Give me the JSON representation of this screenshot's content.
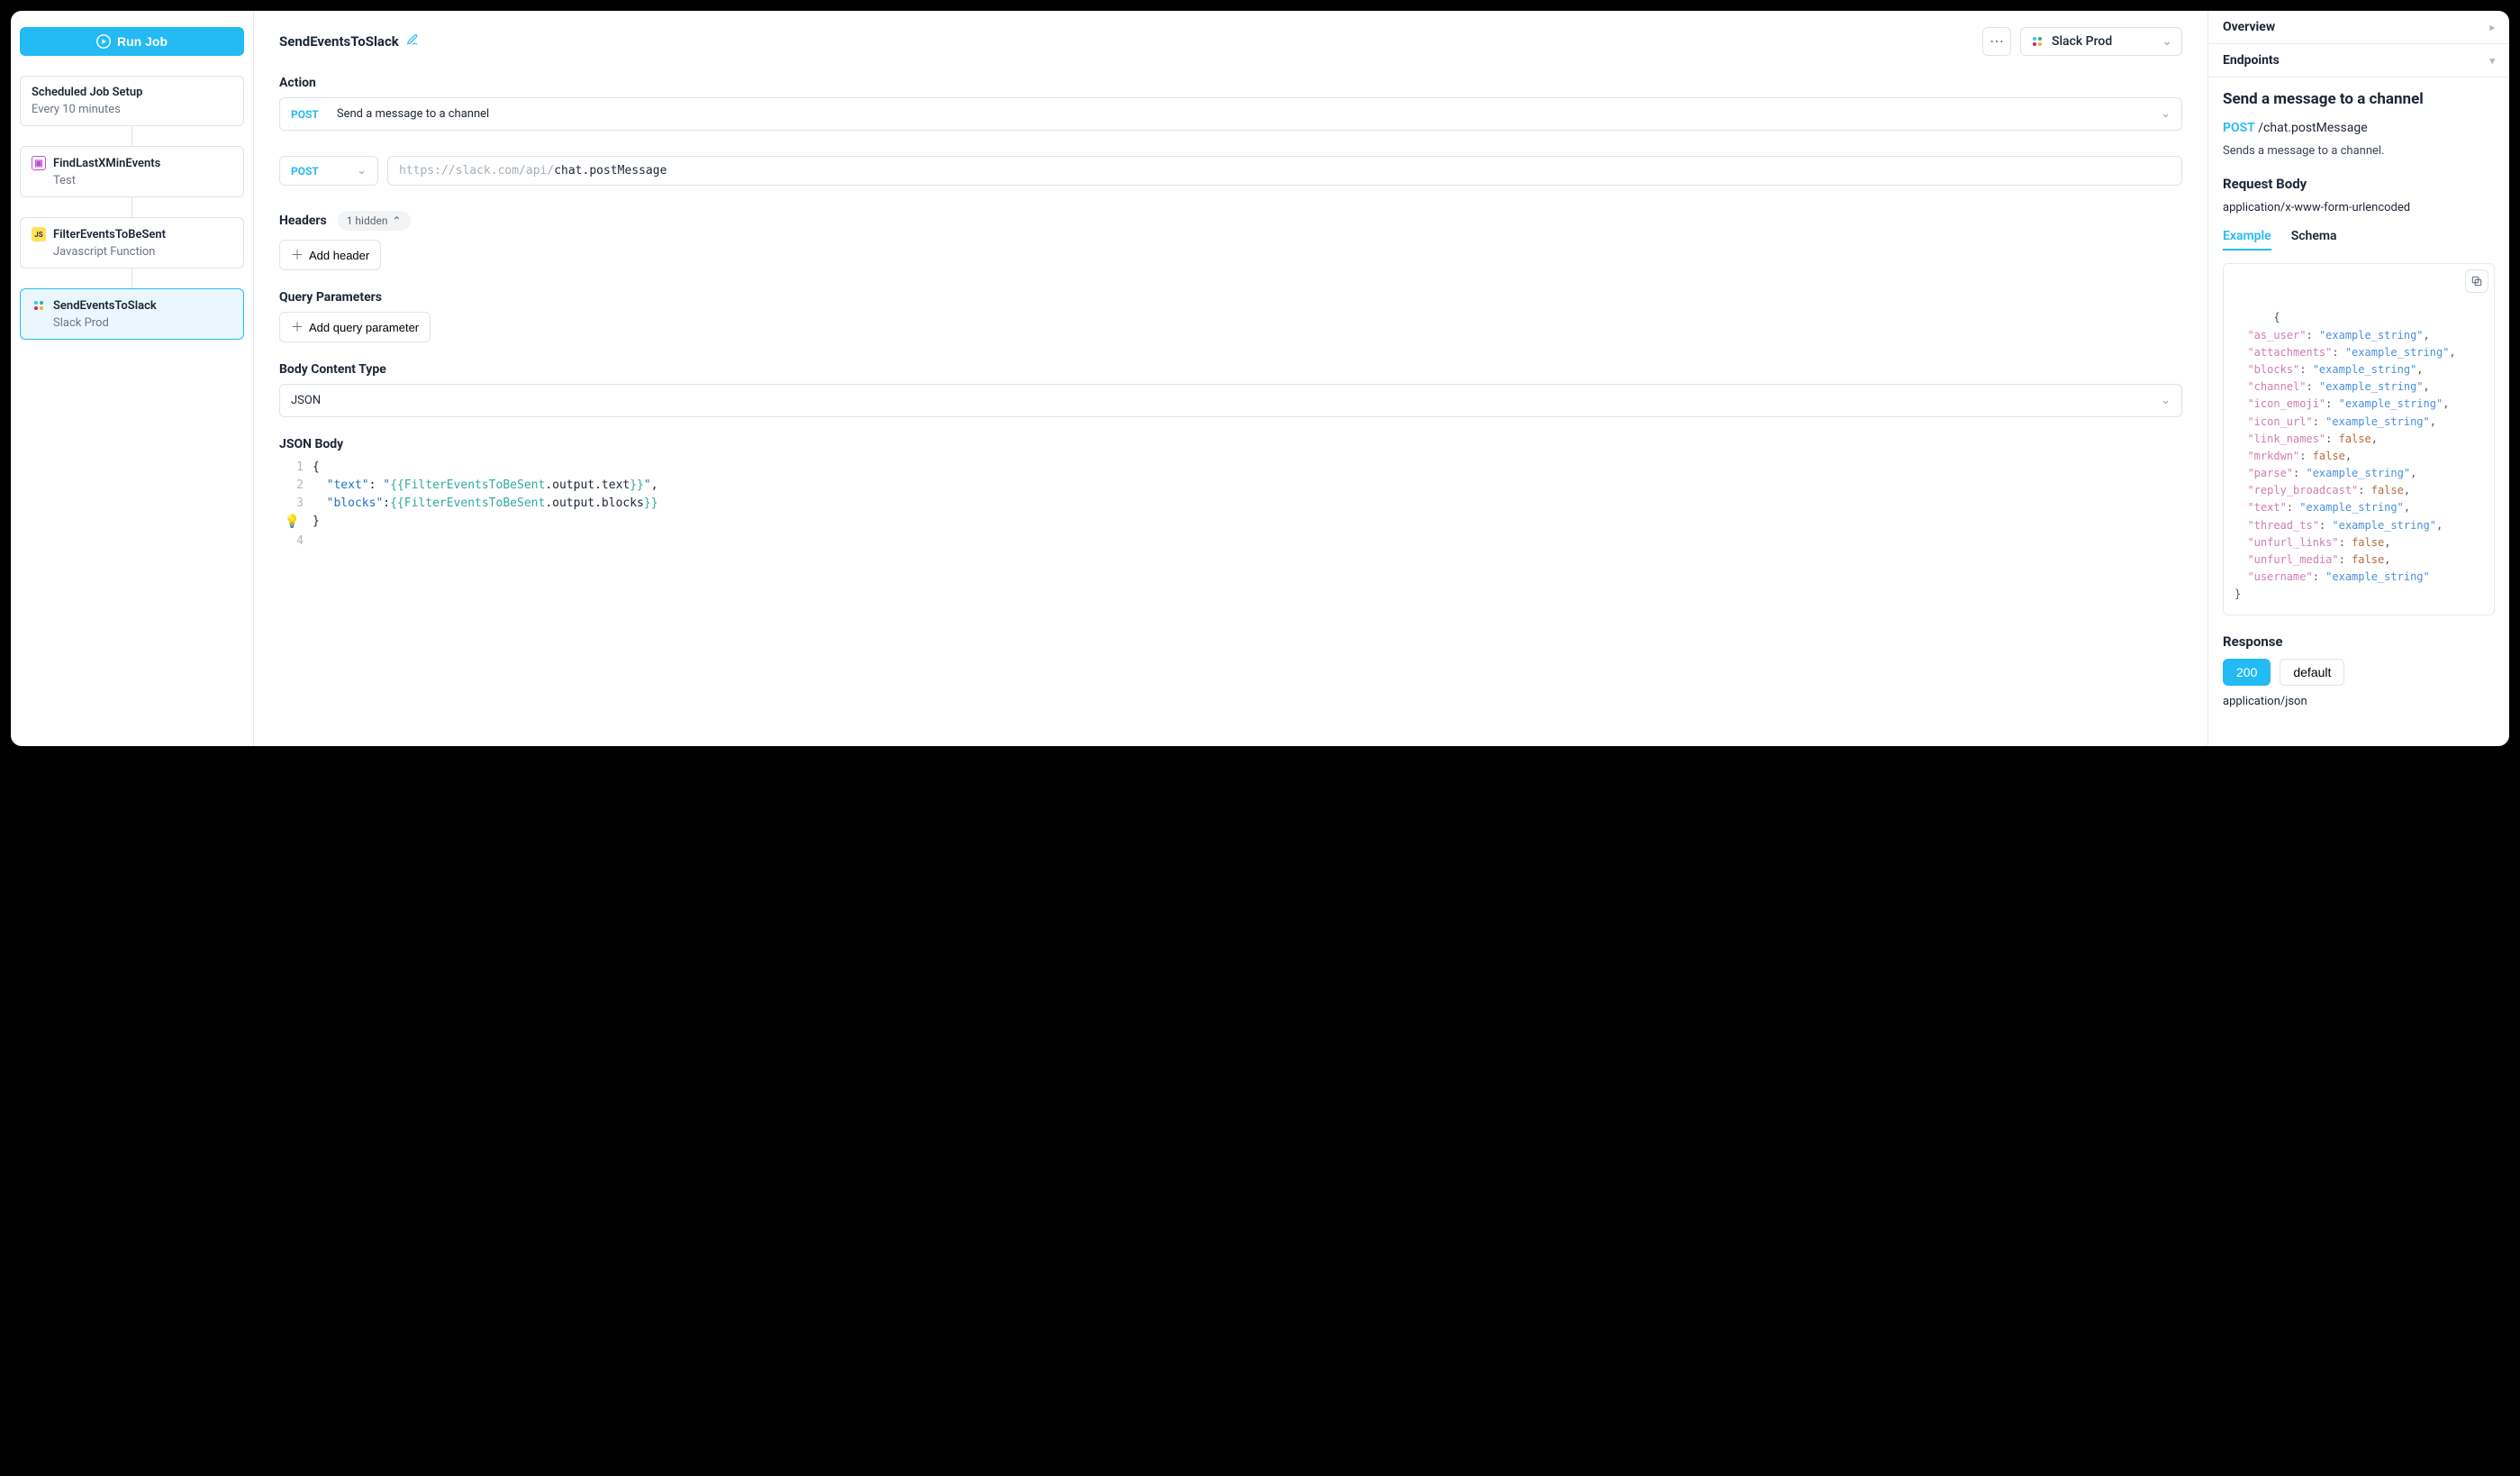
{
  "sidebar": {
    "run_label": "Run Job",
    "nodes": [
      {
        "title": "Scheduled Job Setup",
        "subtitle": "Every 10 minutes",
        "icon": null
      },
      {
        "title": "FindLastXMinEvents",
        "subtitle": "Test",
        "icon": "pink"
      },
      {
        "title": "FilterEventsToBeSent",
        "subtitle": "Javascript Function",
        "icon": "js"
      },
      {
        "title": "SendEventsToSlack",
        "subtitle": "Slack Prod",
        "icon": "slack"
      }
    ]
  },
  "main": {
    "title": "SendEventsToSlack",
    "integration_label": "Slack Prod",
    "action_label": "Action",
    "action_method": "POST",
    "action_text": "Send a message to a channel",
    "req_method": "POST",
    "url_prefix": "https://slack.com/api/",
    "url_path": "chat.postMessage",
    "headers_label": "Headers",
    "headers_hidden": "1 hidden",
    "add_header": "Add header",
    "query_label": "Query Parameters",
    "add_query": "Add query parameter",
    "body_type_label": "Body Content Type",
    "body_type_value": "JSON",
    "json_body_label": "JSON Body",
    "json_lines": [
      {
        "n": "1",
        "tokens": [
          [
            "brace",
            "{"
          ]
        ]
      },
      {
        "n": "2",
        "tokens": [
          [
            "indent",
            "  "
          ],
          [
            "key",
            "\"text\""
          ],
          [
            "punct",
            ": "
          ],
          [
            "str",
            "\""
          ],
          [
            "varb",
            "{{"
          ],
          [
            "var",
            "FilterEventsToBeSent"
          ],
          [
            "punct2",
            ".output.text"
          ],
          [
            "varb",
            "}}"
          ],
          [
            "str",
            "\""
          ],
          [
            "punct",
            ","
          ]
        ]
      },
      {
        "n": "3",
        "tokens": [
          [
            "indent",
            "  "
          ],
          [
            "key",
            "\"blocks\""
          ],
          [
            "punct",
            ":"
          ],
          [
            "varb",
            "{{"
          ],
          [
            "var",
            "FilterEventsToBeSent"
          ],
          [
            "punct2",
            ".output.blocks"
          ],
          [
            "varb",
            "}}"
          ]
        ]
      },
      {
        "n": "4",
        "tokens": [
          [
            "brace",
            "}"
          ]
        ]
      }
    ]
  },
  "right": {
    "overview": "Overview",
    "endpoints": "Endpoints",
    "title": "Send a message to a channel",
    "method": "POST",
    "path": "/chat.postMessage",
    "desc": "Sends a message to a channel.",
    "req_body_label": "Request Body",
    "content_type": "application/x-www-form-urlencoded",
    "tab_example": "Example",
    "tab_schema": "Schema",
    "example_pairs": [
      [
        "as_user",
        "\"example_string\""
      ],
      [
        "attachments",
        "\"example_string\""
      ],
      [
        "blocks",
        "\"example_string\""
      ],
      [
        "channel",
        "\"example_string\""
      ],
      [
        "icon_emoji",
        "\"example_string\""
      ],
      [
        "icon_url",
        "\"example_string\""
      ],
      [
        "link_names",
        "false"
      ],
      [
        "mrkdwn",
        "false"
      ],
      [
        "parse",
        "\"example_string\""
      ],
      [
        "reply_broadcast",
        "false"
      ],
      [
        "text",
        "\"example_string\""
      ],
      [
        "thread_ts",
        "\"example_string\""
      ],
      [
        "unfurl_links",
        "false"
      ],
      [
        "unfurl_media",
        "false"
      ],
      [
        "username",
        "\"example_string\""
      ]
    ],
    "response_label": "Response",
    "resp_200": "200",
    "resp_default": "default",
    "resp_ct": "application/json"
  }
}
